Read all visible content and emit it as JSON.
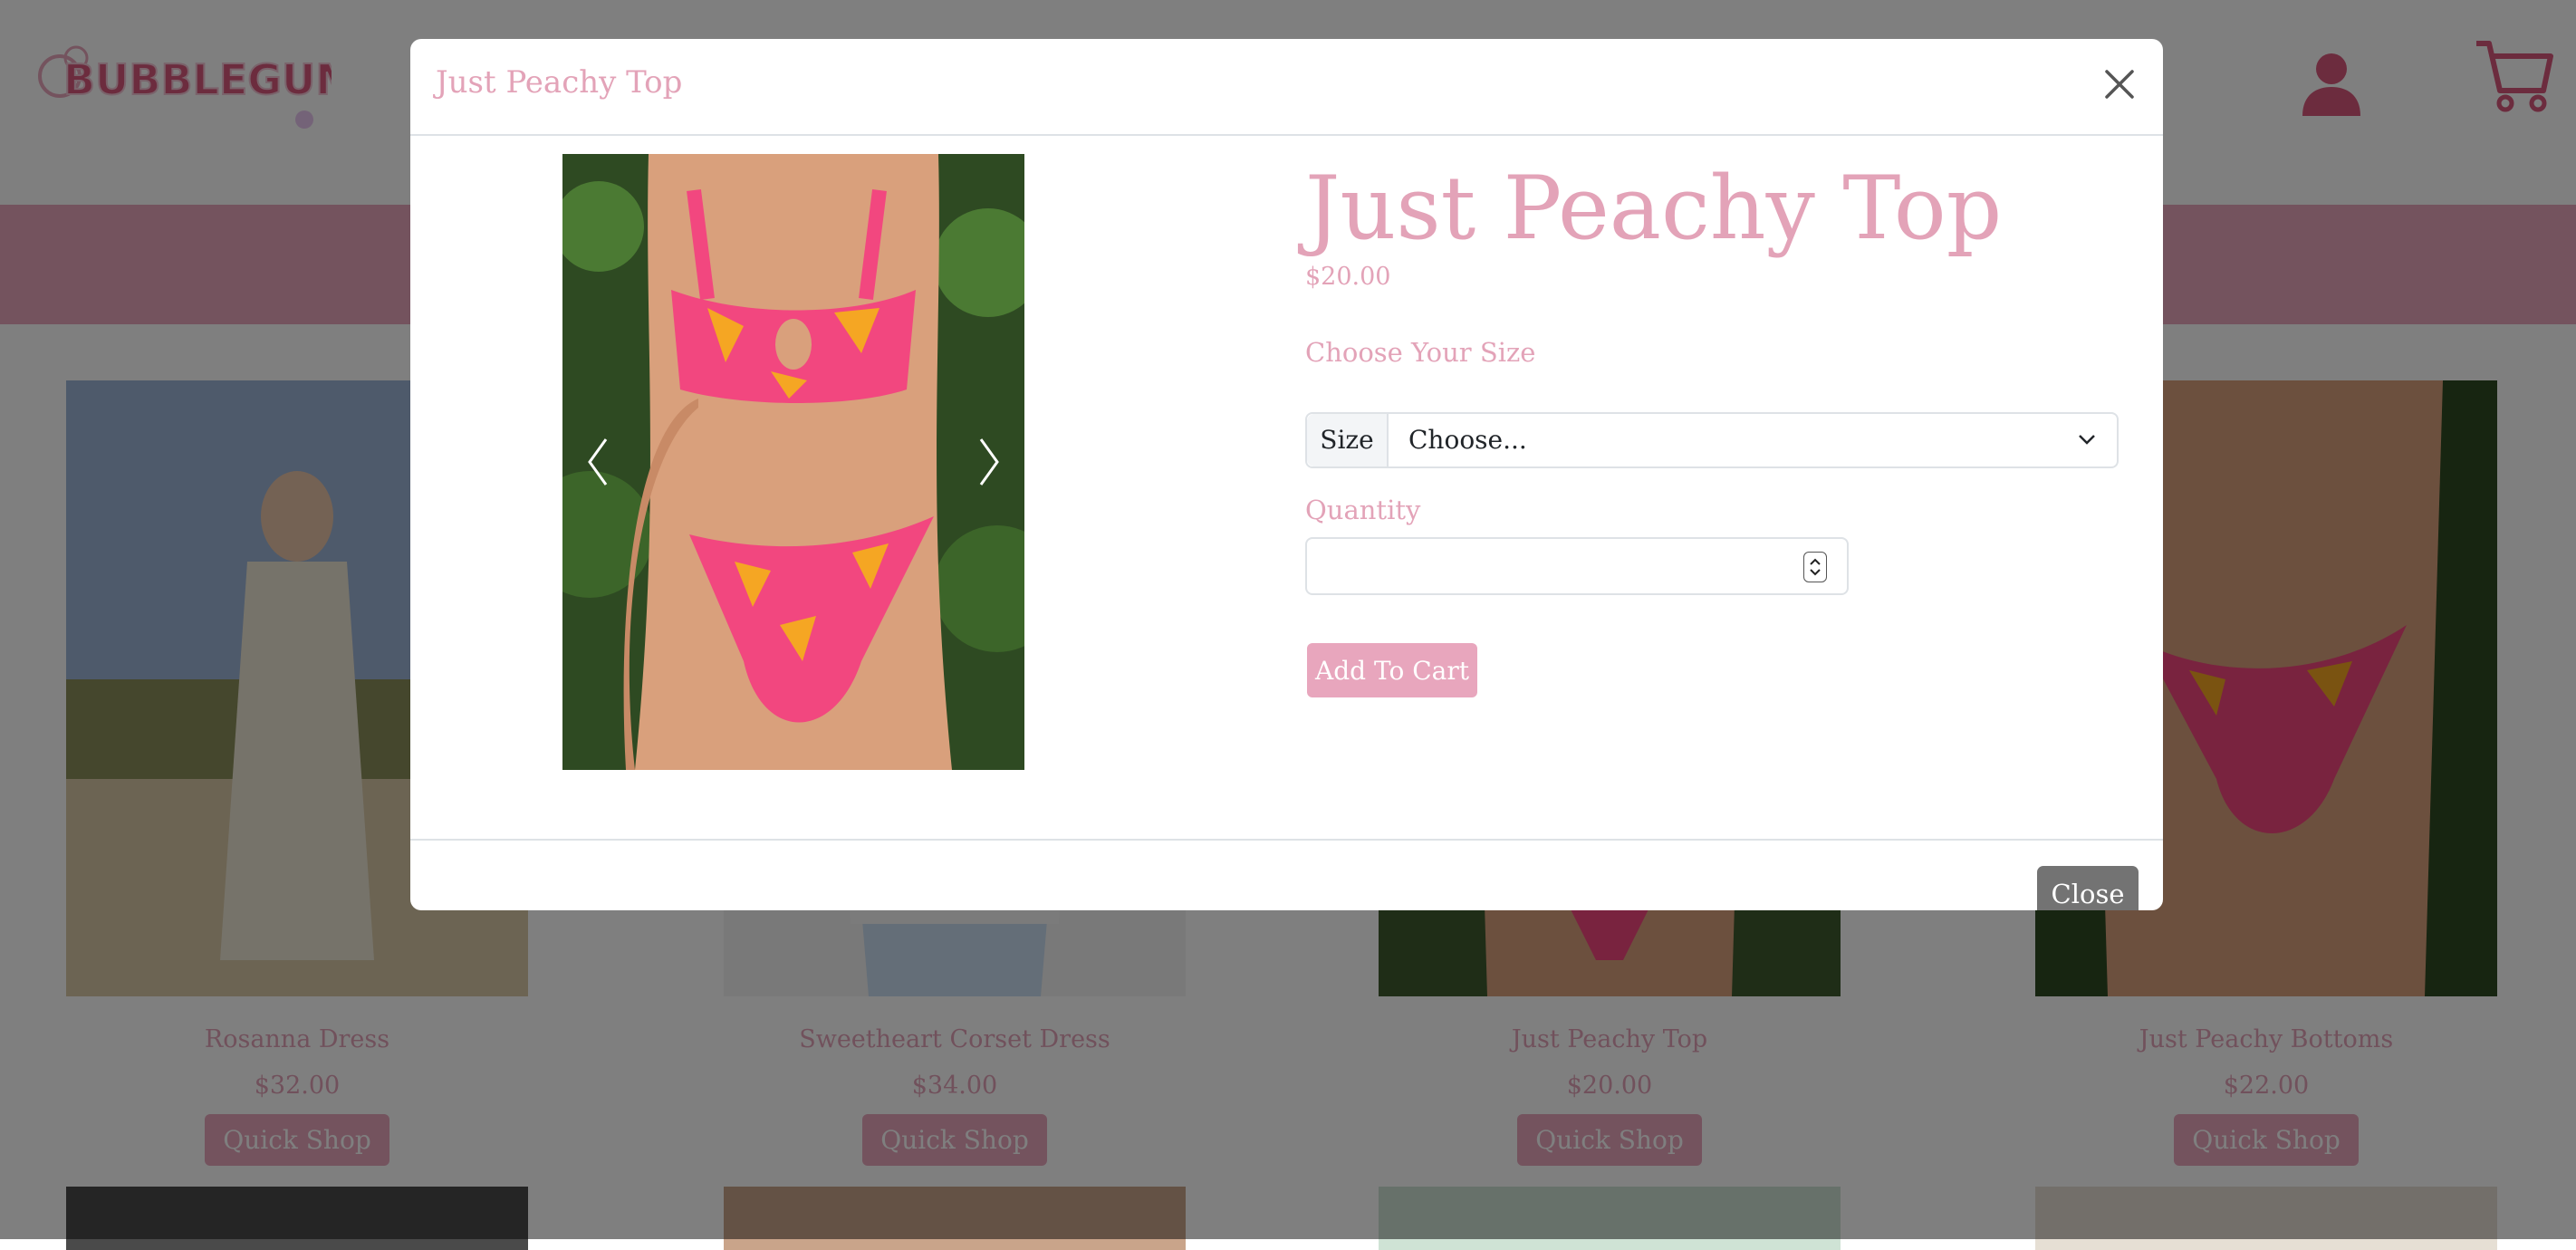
{
  "brand": {
    "logo_text": "BUBBLEGUM",
    "accent_color": "#e8a6bd",
    "text_color": "#e3a3b8"
  },
  "header": {
    "icons": [
      "user-icon",
      "cart-icon"
    ]
  },
  "products": [
    {
      "name": "Rosanna Dress",
      "price": "$32.00",
      "button": "Quick Shop"
    },
    {
      "name": "Sweetheart Corset Dress",
      "price": "$34.00",
      "button": "Quick Shop"
    },
    {
      "name": "Just Peachy Top",
      "price": "$20.00",
      "button": "Quick Shop"
    },
    {
      "name": "Just Peachy Bottoms",
      "price": "$22.00",
      "button": "Quick Shop"
    }
  ],
  "modal": {
    "header_title": "Just Peachy Top",
    "title": "Just Peachy Top",
    "price": "$20.00",
    "size_heading": "Choose Your Size",
    "size_label": "Size",
    "size_selected": "Choose...",
    "quantity_label": "Quantity",
    "quantity_value": "",
    "add_to_cart": "Add To Cart",
    "close_label": "Close"
  }
}
